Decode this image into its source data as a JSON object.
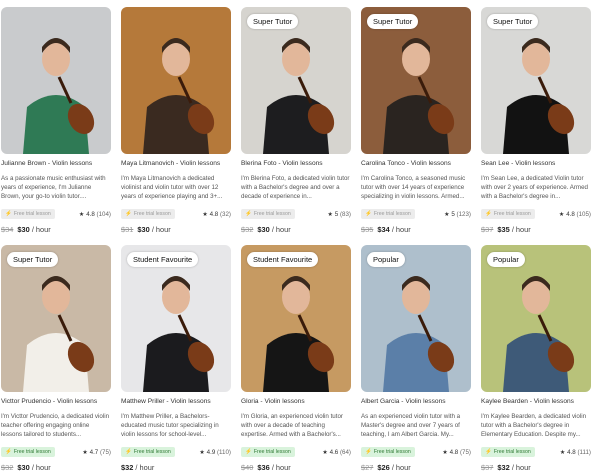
{
  "tutors": [
    {
      "badge": "",
      "name": "Julianne Brown - Violin lessons",
      "desc": "As a passionate music enthusiast with years of experience, I'm Julianne Brown, your go-to violin tutor....",
      "trial": "Free trial lesson",
      "trial_style": "grey",
      "rating": "4.8",
      "reviews": "(104)",
      "old_price": "$34",
      "price": "$30",
      "unit": "/ hour",
      "bg": "#c9cbcd",
      "fg": "#2f7a55"
    },
    {
      "badge": "",
      "name": "Maya Litmanovich - Violin lessons",
      "desc": "I'm Maya Litmanovich a dedicated violinist and violin tutor with over 12 years of experience playing and 3+...",
      "trial": "Free trial lesson",
      "trial_style": "grey",
      "rating": "4.8",
      "reviews": "(32)",
      "old_price": "$31",
      "price": "$30",
      "unit": "/ hour",
      "bg": "#b5793a",
      "fg": "#3a2a20"
    },
    {
      "badge": "Super Tutor",
      "name": "Blerina Foto - Violin lessons",
      "desc": "I'm Blerina Foto, a dedicated violin tutor with a Bachelor's degree and over a decade of experience in...",
      "trial": "Free trial lesson",
      "trial_style": "grey",
      "rating": "5",
      "reviews": "(83)",
      "old_price": "$32",
      "price": "$30",
      "unit": "/ hour",
      "bg": "#d6d4cf",
      "fg": "#1d1d1f"
    },
    {
      "badge": "Super Tutor",
      "name": "Carolina Tonco - Violin lessons",
      "desc": "I'm Carolina Tonco, a seasoned music tutor with over 14 years of experience specializing in violin lessons. Armed...",
      "trial": "Free trial lesson",
      "trial_style": "grey",
      "rating": "5",
      "reviews": "(123)",
      "old_price": "$35",
      "price": "$34",
      "unit": "/ hour",
      "bg": "#8c5d3c",
      "fg": "#2a2420"
    },
    {
      "badge": "Super Tutor",
      "name": "Sean Lee - Violin lessons",
      "desc": "I'm Sean Lee, a dedicated Violin tutor with over 2 years of experience. Armed with a Bachelor's degree in...",
      "trial": "Free trial lesson",
      "trial_style": "grey",
      "rating": "4.8",
      "reviews": "(105)",
      "old_price": "$37",
      "price": "$35",
      "unit": "/ hour",
      "bg": "#d8d8d6",
      "fg": "#121212"
    },
    {
      "badge": "Super Tutor",
      "name": "Victtor Prudencio - Violin lessons",
      "desc": "I'm Victtor Prudencio, a dedicated violin teacher offering engaging online lessons tailored to students...",
      "trial": "Free trial lesson",
      "trial_style": "green",
      "rating": "4.7",
      "reviews": "(75)",
      "old_price": "$32",
      "price": "$30",
      "unit": "/ hour",
      "bg": "#c9b9a6",
      "fg": "#f2efe9"
    },
    {
      "badge": "Student Favourite",
      "name": "Matthew Priller - Violin lessons",
      "desc": "I'm Matthew Priller, a Bachelors-educated music tutor specializing in violin lessons for school-level...",
      "trial": "Free trial lesson",
      "trial_style": "green",
      "rating": "4.9",
      "reviews": "(110)",
      "old_price": "",
      "price": "$32",
      "unit": "/ hour",
      "bg": "#e7e7e9",
      "fg": "#1b1b1e"
    },
    {
      "badge": "Student Favourite",
      "name": "Gloria - Violin lessons",
      "desc": "I'm Gloria, an experienced violin tutor with over a decade of teaching expertise. Armed with a Bachelor's...",
      "trial": "Free trial lesson",
      "trial_style": "green",
      "rating": "4.6",
      "reviews": "(64)",
      "old_price": "$40",
      "price": "$36",
      "unit": "/ hour",
      "bg": "#c69a62",
      "fg": "#151515"
    },
    {
      "badge": "Popular",
      "name": "Albert Garcia - Violin lessons",
      "desc": "As an experienced violin tutor with a Master's degree and over 7 years of teaching, I am Albert Garcia. My...",
      "trial": "Free trial lesson",
      "trial_style": "green",
      "rating": "4.8",
      "reviews": "(75)",
      "old_price": "$27",
      "price": "$26",
      "unit": "/ hour",
      "bg": "#aebfcc",
      "fg": "#5b7fa8"
    },
    {
      "badge": "Popular",
      "name": "Kaylee Bearden - Violin lessons",
      "desc": "I'm Kaylee Bearden, a dedicated violin tutor with a Bachelor's degree in Elementary Education. Despite my...",
      "trial": "Free trial lesson",
      "trial_style": "green",
      "rating": "4.8",
      "reviews": "(111)",
      "old_price": "$37",
      "price": "$32",
      "unit": "/ hour",
      "bg": "#b8c27a",
      "fg": "#3e5a78"
    }
  ],
  "icons": {
    "star": "star-icon",
    "bolt": "bolt-icon"
  }
}
